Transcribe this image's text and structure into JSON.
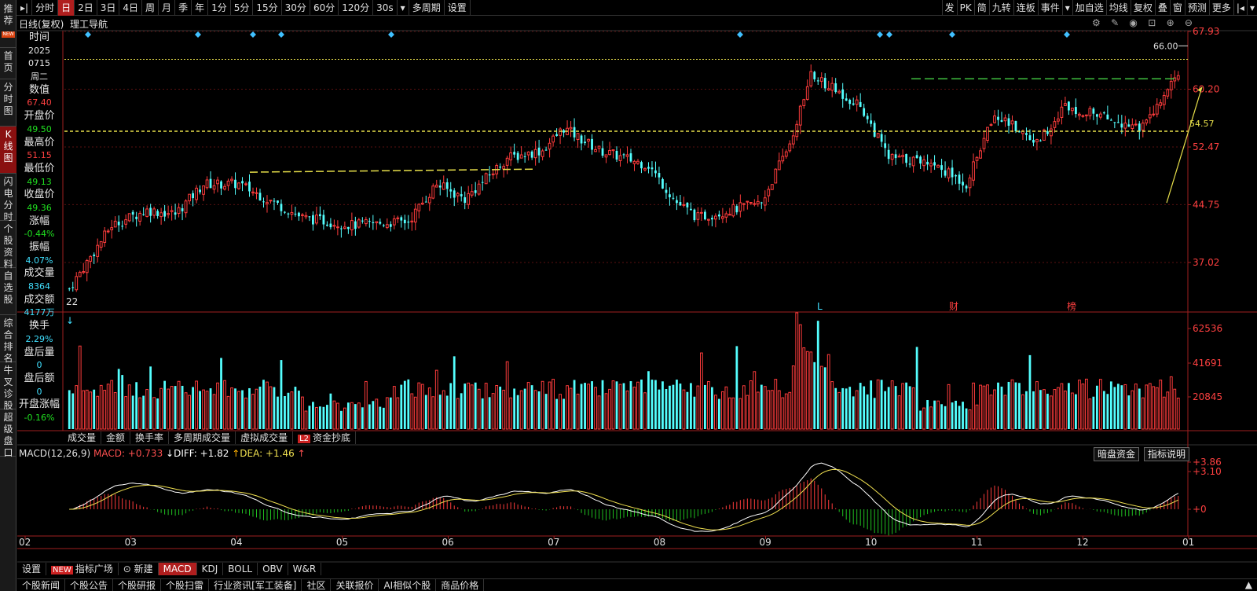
{
  "toolbar": {
    "periods": [
      "分时",
      "日",
      "2日",
      "3日",
      "4日",
      "周",
      "月",
      "季",
      "年",
      "1分",
      "5分",
      "15分",
      "30分",
      "60分",
      "120分",
      "30s",
      "多周期",
      "设置"
    ],
    "active_period": "日",
    "right_buttons": [
      "发",
      "PK",
      "简",
      "九转",
      "连板",
      "事件",
      "加自选",
      "均线",
      "复权",
      "叠",
      "窗",
      "预测",
      "更多"
    ]
  },
  "sidebar": {
    "items": [
      "推荐",
      "首页",
      "分时图",
      "K线图",
      "闪电分时",
      "个股资料",
      "自选股",
      "综合排名",
      "牛叉诊股",
      "超级盘口"
    ],
    "active_item": "K线图",
    "new_badge": "NEW"
  },
  "chart_header": {
    "mode": "日线(复权)",
    "stock": "理工导航"
  },
  "info_panel": [
    {
      "label": "时间",
      "value": "2025",
      "color": "#e8e8e8"
    },
    {
      "label": "",
      "value": "0715",
      "color": "#e8e8e8"
    },
    {
      "label": "",
      "value": "周二",
      "color": "#e8e8e8"
    },
    {
      "label": "数值",
      "value": "67.40",
      "color": "#ff4040"
    },
    {
      "label": "开盘价",
      "value": "49.50",
      "color": "#20e020"
    },
    {
      "label": "最高价",
      "value": "51.15",
      "color": "#ff4040"
    },
    {
      "label": "最低价",
      "value": "49.13",
      "color": "#20e020"
    },
    {
      "label": "收盘价",
      "value": "49.36",
      "color": "#20e020"
    },
    {
      "label": "涨幅",
      "value": "-0.44%",
      "color": "#20e020"
    },
    {
      "label": "振幅",
      "value": "4.07%",
      "color": "#40e0ff"
    },
    {
      "label": "成交量",
      "value": "8364",
      "color": "#40e0ff"
    },
    {
      "label": "成交额",
      "value": "4177万",
      "color": "#40e0ff"
    },
    {
      "label": "换手",
      "value": "2.29%",
      "color": "#40e0ff"
    },
    {
      "label": "盘后量",
      "value": "0",
      "color": "#40e0ff"
    },
    {
      "label": "盘后额",
      "value": "0",
      "color": "#40e0ff"
    },
    {
      "label": "开盘涨幅",
      "value": "-0.16%",
      "color": "#20e020"
    }
  ],
  "price_axis": {
    "ticks": [
      "67.93",
      "60.20",
      "52.47",
      "44.75",
      "37.02"
    ],
    "ylim": [
      30.6,
      67.93
    ]
  },
  "annotations": {
    "high_label": "66.00",
    "support_label": "54.57",
    "start_label": "22",
    "event_markers": [
      "L",
      "财",
      "榜"
    ]
  },
  "volume_axis": {
    "ticks": [
      "62536",
      "41691",
      "20845"
    ]
  },
  "volume_tabs": [
    "成交量",
    "金额",
    "换手率",
    "多周期成交量",
    "虚拟成交量",
    "资金抄底"
  ],
  "volume_tab_l2": "L2",
  "macd_legend": {
    "name": "MACD(12,26,9)",
    "macd": "MACD: +0.733",
    "diff": "DIFF: +1.82",
    "dea": "DEA: +1.46",
    "buttons": [
      "暗盘资金",
      "指标说明"
    ]
  },
  "macd_axis": {
    "ticks": [
      "+3.86",
      "+3.10",
      "+0"
    ]
  },
  "months": [
    "02",
    "03",
    "04",
    "05",
    "06",
    "07",
    "08",
    "09",
    "10",
    "11",
    "12",
    "01"
  ],
  "indicator_tabs": [
    "设置",
    "指标广场",
    "新建",
    "MACD",
    "KDJ",
    "BOLL",
    "OBV",
    "W&R"
  ],
  "indicator_new": "NEW",
  "news_tabs": [
    "个股新闻",
    "个股公告",
    "个股研报",
    "个股扫雷",
    "行业资讯[军工装备]",
    "社区",
    "关联报价",
    "AI相似个股",
    "商品价格"
  ],
  "colors": {
    "up": "#ff3c3c",
    "down": "#54ffff",
    "yellow": "#e8e04a",
    "green_line": "#40c040"
  },
  "chart_data": {
    "type": "candlestick",
    "title": "理工导航",
    "ylim": [
      30.6,
      67.93
    ],
    "high": 66.0,
    "support": 54.57,
    "series_count": 225
  }
}
